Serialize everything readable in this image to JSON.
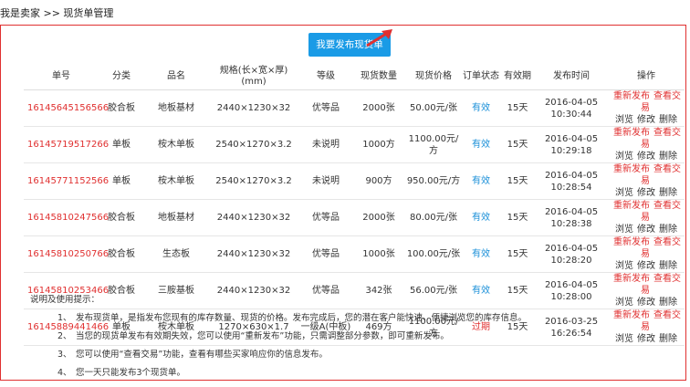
{
  "breadcrumb": "我是卖家 >> 现货单管理",
  "publish_button": "我要发布现货单",
  "headers": [
    "单号",
    "分类",
    "品名",
    "规格(长×宽×厚)",
    "(mm)",
    "等级",
    "现货数量",
    "现货价格",
    "订单状态",
    "有效期",
    "发布时间",
    "操作"
  ],
  "rows": [
    {
      "id": "16145645156566",
      "cat": "胶合板",
      "name": "地板基材",
      "spec": "2440×1230×32",
      "grade": "优等品",
      "qty": "2000张",
      "price": "50.00元/张",
      "status": "有效",
      "valid": "15天",
      "date": "2016-04-05",
      "time": "10:30:44",
      "expired": false
    },
    {
      "id": "16145719517266",
      "cat": "单板",
      "name": "桉木单板",
      "spec": "2540×1270×3.2",
      "grade": "未说明",
      "qty": "1000方",
      "price": "1100.00元/方",
      "status": "有效",
      "valid": "15天",
      "date": "2016-04-05",
      "time": "10:29:18",
      "expired": false
    },
    {
      "id": "16145771152566",
      "cat": "单板",
      "name": "桉木单板",
      "spec": "2540×1270×3.2",
      "grade": "未说明",
      "qty": "900方",
      "price": "950.00元/方",
      "status": "有效",
      "valid": "15天",
      "date": "2016-04-05",
      "time": "10:28:54",
      "expired": false
    },
    {
      "id": "16145810247566",
      "cat": "胶合板",
      "name": "地板基材",
      "spec": "2440×1230×32",
      "grade": "优等品",
      "qty": "2000张",
      "price": "80.00元/张",
      "status": "有效",
      "valid": "15天",
      "date": "2016-04-05",
      "time": "10:28:38",
      "expired": false
    },
    {
      "id": "16145810250766",
      "cat": "胶合板",
      "name": "生态板",
      "spec": "2440×1230×32",
      "grade": "优等品",
      "qty": "1000张",
      "price": "100.00元/张",
      "status": "有效",
      "valid": "15天",
      "date": "2016-04-05",
      "time": "10:28:20",
      "expired": false
    },
    {
      "id": "16145810253466",
      "cat": "胶合板",
      "name": "三胺基板",
      "spec": "2440×1230×32",
      "grade": "优等品",
      "qty": "342张",
      "price": "56.00元/张",
      "status": "有效",
      "valid": "15天",
      "date": "2016-04-05",
      "time": "10:28:00",
      "expired": false
    },
    {
      "id": "16145889441466",
      "cat": "单板",
      "name": "桉木单板",
      "spec": "1270×630×1.7",
      "grade": "一级A(中板)",
      "qty": "469方",
      "price": "1100.00元/方",
      "status": "过期",
      "valid": "15天",
      "date": "2016-03-25",
      "time": "16:26:54",
      "expired": true
    }
  ],
  "ops": {
    "republish": "重新发布",
    "view_trade": "查看交易",
    "browse": "浏览",
    "edit": "修改",
    "delete": "删除"
  },
  "notes": {
    "title": "说明及使用提示：",
    "items": [
      {
        "num": "1、",
        "text": "发布现货单，是指发布您现有的库存数量、现货的价格。发布完成后，您的潜在客户能快速、便捷浏览您的库存信息。"
      },
      {
        "num": "2、",
        "text": "当您的现货单发布有效期失效，您可以使用“重新发布”功能，只需调整部分参数，即可重新发布。"
      },
      {
        "num": "3、",
        "text": "您可以使用“查看交易”功能，查看有哪些买家响应你的信息发布。"
      },
      {
        "num": "4、",
        "text": "您一天只能发布3个现货单。"
      }
    ]
  },
  "colors": {
    "accent": "#1a9be6",
    "red": "#e03030",
    "valid": "#1a8fd8"
  }
}
